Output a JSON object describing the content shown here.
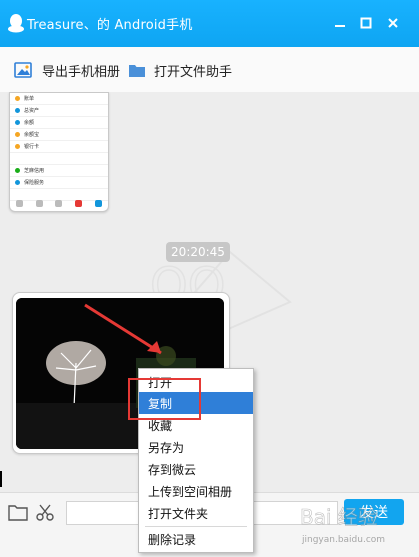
{
  "window": {
    "title": "Treasure、的 Android手机",
    "controls": [
      "minimize-icon",
      "maximize-icon",
      "close-icon"
    ]
  },
  "toolbar": {
    "export_label": "导出手机相册",
    "open_assistant_label": "打开文件助手"
  },
  "phone_screenshot": {
    "rows": [
      {
        "label": "账单",
        "color": "#f5a623"
      },
      {
        "label": "总资产",
        "extra": "",
        "color": "#1296db"
      },
      {
        "label": "余额",
        "extra": "",
        "color": "#1296db"
      },
      {
        "label": "余额宝",
        "color": "#f5a623"
      },
      {
        "label": "银行卡",
        "color": "#f5a623"
      },
      {
        "label": "",
        "color": "#ffffff"
      },
      {
        "label": "芝麻信用",
        "color": "#1aad19"
      },
      {
        "label": "保险服务",
        "color": "#1296db"
      },
      {
        "label": "",
        "color": "#ffffff"
      }
    ]
  },
  "chat": {
    "timestamp": "20:20:45"
  },
  "context_menu": {
    "items": [
      "打开",
      "复制",
      "收藏",
      "另存为",
      "存到微云",
      "上传到空间相册",
      "打开文件夹",
      "删除记录"
    ],
    "selected": "复制"
  },
  "bottom": {
    "send_label": "发送"
  },
  "watermark": {
    "text": "Bai 经验",
    "url": "jingyan.baidu.com"
  },
  "colors": {
    "titlebar": "#12a9f5",
    "selection": "#2f7fd8",
    "highlight_box": "#e53935",
    "send_button": "#12a5ef"
  }
}
